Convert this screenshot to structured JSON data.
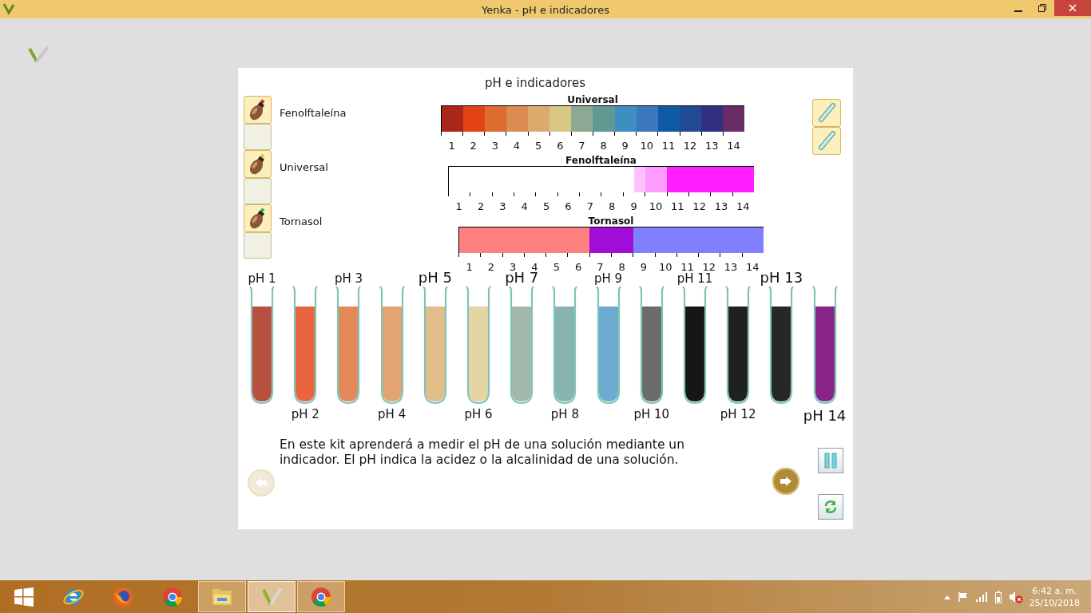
{
  "window": {
    "title": "Yenka - pH e indicadores"
  },
  "activity": {
    "title": "pH e indicadores",
    "indicators": [
      {
        "name": "Fenolftaleína",
        "color": "#d01818"
      },
      {
        "name": "Universal",
        "color": "#f0c020"
      },
      {
        "name": "Tornasol",
        "color": "#30b040"
      }
    ],
    "scales": [
      {
        "title": "Universal",
        "labels": [
          "1",
          "2",
          "3",
          "4",
          "5",
          "6",
          "7",
          "8",
          "9",
          "10",
          "11",
          "12",
          "13",
          "14"
        ],
        "bands": [
          {
            "color": "#a8261a"
          },
          {
            "color": "#e34317"
          },
          {
            "color": "#de6b30"
          },
          {
            "color": "#db8c51"
          },
          {
            "color": "#dbab6e"
          },
          {
            "color": "#d9c885"
          },
          {
            "color": "#8da893"
          },
          {
            "color": "#5f9991"
          },
          {
            "color": "#3f8ebf"
          },
          {
            "color": "#3a77bf"
          },
          {
            "color": "#0e5aa6"
          },
          {
            "color": "#214a94"
          },
          {
            "color": "#302f80"
          },
          {
            "color": "#6a2c66"
          }
        ]
      },
      {
        "title": "Fenolftaleína",
        "labels": [
          "1",
          "2",
          "3",
          "4",
          "5",
          "6",
          "7",
          "8",
          "9",
          "10",
          "11",
          "12",
          "13",
          "14"
        ],
        "bands": [
          {
            "color": "#ffffff"
          },
          {
            "color": "#ffffff"
          },
          {
            "color": "#ffffff"
          },
          {
            "color": "#ffffff"
          },
          {
            "color": "#ffffff"
          },
          {
            "color": "#ffffff"
          },
          {
            "color": "#ffffff"
          },
          {
            "color": "#ffffff"
          },
          {
            "color": "#ffffff"
          },
          {
            "color": "#ffffff"
          },
          {
            "color": "#ffffff"
          },
          {
            "color": "#ffffff"
          },
          {
            "color": "#ffffff"
          },
          {
            "color": "#ffffff"
          },
          {
            "color": "#ffffff"
          },
          {
            "color": "#ffffff"
          },
          {
            "color": "#ffffff"
          },
          {
            "color": "#ffc2ff"
          },
          {
            "color": "#ff9cff"
          },
          {
            "color": "#ff9cff"
          },
          {
            "color": "#ff1fff"
          },
          {
            "color": "#ff1fff"
          },
          {
            "color": "#ff1fff"
          },
          {
            "color": "#ff1fff"
          },
          {
            "color": "#ff1fff"
          },
          {
            "color": "#ff1fff"
          },
          {
            "color": "#ff1fff"
          },
          {
            "color": "#ff1fff"
          }
        ]
      },
      {
        "title": "Tornasol",
        "labels": [
          "1",
          "2",
          "3",
          "4",
          "5",
          "6",
          "7",
          "8",
          "9",
          "10",
          "11",
          "12",
          "13",
          "14"
        ],
        "bands": [
          {
            "color": "#ff8080"
          },
          {
            "color": "#ff8080"
          },
          {
            "color": "#ff8080"
          },
          {
            "color": "#ff8080"
          },
          {
            "color": "#ff8080"
          },
          {
            "color": "#ff8080"
          },
          {
            "color": "#ff8080"
          },
          {
            "color": "#ff8080"
          },
          {
            "color": "#ff8080"
          },
          {
            "color": "#ff8080"
          },
          {
            "color": "#ff8080"
          },
          {
            "color": "#ff8080"
          },
          {
            "color": "#a00cd8"
          },
          {
            "color": "#a00cd8"
          },
          {
            "color": "#a00cd8"
          },
          {
            "color": "#a00cd8"
          },
          {
            "color": "#8080ff"
          },
          {
            "color": "#8080ff"
          },
          {
            "color": "#8080ff"
          },
          {
            "color": "#8080ff"
          },
          {
            "color": "#8080ff"
          },
          {
            "color": "#8080ff"
          },
          {
            "color": "#8080ff"
          },
          {
            "color": "#8080ff"
          },
          {
            "color": "#8080ff"
          },
          {
            "color": "#8080ff"
          },
          {
            "color": "#8080ff"
          },
          {
            "color": "#8080ff"
          }
        ]
      }
    ],
    "tubes": [
      {
        "label": "pH 1",
        "emphasis": false,
        "color": "#b85040"
      },
      {
        "label": "pH 2",
        "emphasis": false,
        "color": "#e86540"
      },
      {
        "label": "pH 3",
        "emphasis": false,
        "color": "#e6895a"
      },
      {
        "label": "pH 4",
        "emphasis": false,
        "color": "#e2a470"
      },
      {
        "label": "pH 5",
        "emphasis": true,
        "color": "#e2bd8a"
      },
      {
        "label": "pH 6",
        "emphasis": false,
        "color": "#e4d5a2"
      },
      {
        "label": "pH 7",
        "emphasis": true,
        "color": "#a2b8aa"
      },
      {
        "label": "pH 8",
        "emphasis": false,
        "color": "#88b4b0"
      },
      {
        "label": "pH 9",
        "emphasis": false,
        "color": "#6eabd0"
      },
      {
        "label": "pH 10",
        "emphasis": false,
        "color": "#6b6b6b"
      },
      {
        "label": "pH 11",
        "emphasis": false,
        "color": "#161616"
      },
      {
        "label": "pH 12",
        "emphasis": false,
        "color": "#202020"
      },
      {
        "label": "pH 13",
        "emphasis": true,
        "color": "#272727"
      },
      {
        "label": "pH 14",
        "emphasis": true,
        "color": "#8a2487"
      }
    ],
    "description": "En este kit aprenderá a medir el pH de una solución mediante un indicador. El pH indica la acidez o la alcalinidad de una solución.",
    "previous": {
      "disabled": true
    },
    "next": {
      "disabled": false
    }
  },
  "taskbar": {
    "apps": [
      {
        "kind": "ie",
        "active": false
      },
      {
        "kind": "firefox",
        "active": false
      },
      {
        "kind": "chrome",
        "active": false
      },
      {
        "kind": "folder",
        "active": false,
        "pinned_open": true
      },
      {
        "kind": "yenka",
        "active": true
      },
      {
        "kind": "chrome",
        "active": false,
        "pinned_open": true
      }
    ],
    "time": "6:42 a. m.",
    "date": "25/10/2018"
  }
}
